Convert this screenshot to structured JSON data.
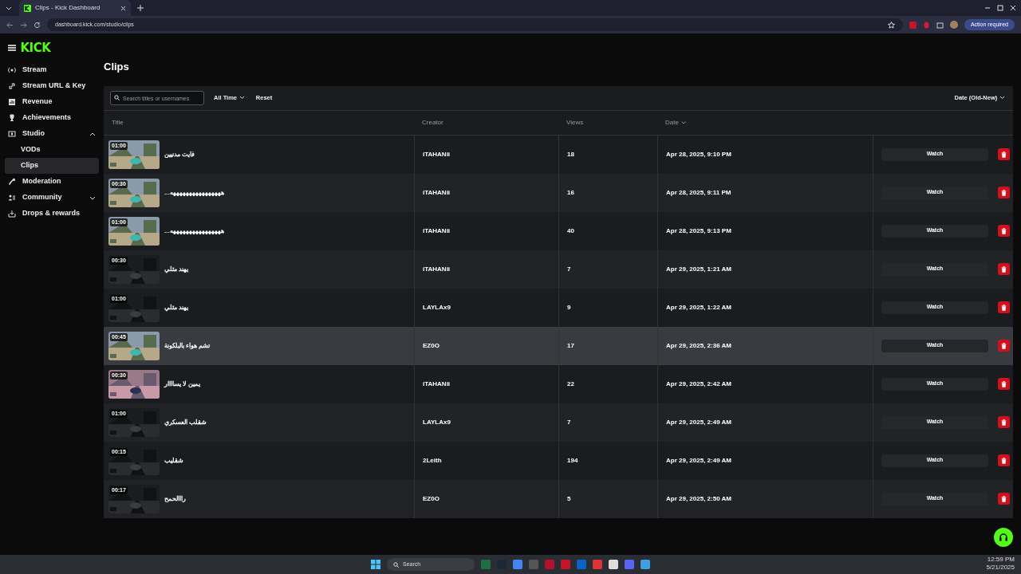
{
  "browser": {
    "tab_title": "Clips - Kick Dashboard",
    "url": "dashboard.kick.com/studio/clips",
    "action_button": "Action required"
  },
  "logo": "KICK",
  "sidebar": {
    "items": [
      {
        "label": "Stream",
        "selected": false
      },
      {
        "label": "Stream URL & Key",
        "selected": false
      },
      {
        "label": "Revenue",
        "selected": false
      },
      {
        "label": "Achievements",
        "selected": false
      },
      {
        "label": "Studio",
        "selected": false,
        "expanded": true,
        "children": [
          {
            "label": "VODs",
            "selected": false
          },
          {
            "label": "Clips",
            "selected": true
          }
        ]
      },
      {
        "label": "Moderation",
        "selected": false
      },
      {
        "label": "Community",
        "selected": false,
        "expanded": false
      },
      {
        "label": "Drops & rewards",
        "selected": false
      }
    ]
  },
  "page_title": "Clips",
  "toolbar": {
    "search_placeholder": "Search titles or usernames",
    "range": "All Time",
    "reset": "Reset",
    "sort": "Date (Old-New)"
  },
  "table": {
    "columns": [
      "Title",
      "Creator",
      "Views",
      "Date"
    ],
    "rows": [
      {
        "duration": "01:00",
        "title": "فايت مدنيين",
        "creator": "iTAHANii",
        "views": "18",
        "date": "Apr 28, 2025, 9:10 PM",
        "hovered": false,
        "watch": "Watch"
      },
      {
        "duration": "00:30",
        "title": "ههههههههههههههههه...",
        "creator": "iTAHANii",
        "views": "16",
        "date": "Apr 28, 2025, 9:11 PM",
        "hovered": false,
        "watch": "Watch"
      },
      {
        "duration": "01:00",
        "title": "ههههههههههههههههه...",
        "creator": "iTAHANii",
        "views": "40",
        "date": "Apr 28, 2025, 9:13 PM",
        "hovered": false,
        "watch": "Watch"
      },
      {
        "duration": "00:30",
        "title": "يهند مثلي",
        "creator": "iTAHANii",
        "views": "7",
        "date": "Apr 29, 2025, 1:21 AM",
        "hovered": false,
        "watch": "Watch"
      },
      {
        "duration": "01:00",
        "title": "يهند مثلي",
        "creator": "LAYLAx9",
        "views": "9",
        "date": "Apr 29, 2025, 1:22 AM",
        "hovered": false,
        "watch": "Watch"
      },
      {
        "duration": "00:45",
        "title": "تشم هواء بالبلكونة",
        "creator": "EZ0O",
        "views": "17",
        "date": "Apr 29, 2025, 2:36 AM",
        "hovered": true,
        "watch": "Watch"
      },
      {
        "duration": "00:30",
        "title": "يمين لا يساااار",
        "creator": "iTAHANii",
        "views": "22",
        "date": "Apr 29, 2025, 2:42 AM",
        "hovered": false,
        "watch": "Watch"
      },
      {
        "duration": "01:00",
        "title": "شقلب العسكري",
        "creator": "LAYLAx9",
        "views": "7",
        "date": "Apr 29, 2025, 2:49 AM",
        "hovered": false,
        "watch": "Watch"
      },
      {
        "duration": "00:15",
        "title": "شقليب",
        "creator": "2Leith",
        "views": "194",
        "date": "Apr 29, 2025, 2:49 AM",
        "hovered": false,
        "watch": "Watch"
      },
      {
        "duration": "00:17",
        "title": "رااالحمح",
        "creator": "EZ0O",
        "views": "5",
        "date": "Apr 29, 2025, 2:50 AM",
        "hovered": false,
        "watch": "Watch"
      }
    ]
  },
  "taskbar": {
    "search": "Search",
    "time": "12:59 PM",
    "date": "5/21/2025"
  }
}
